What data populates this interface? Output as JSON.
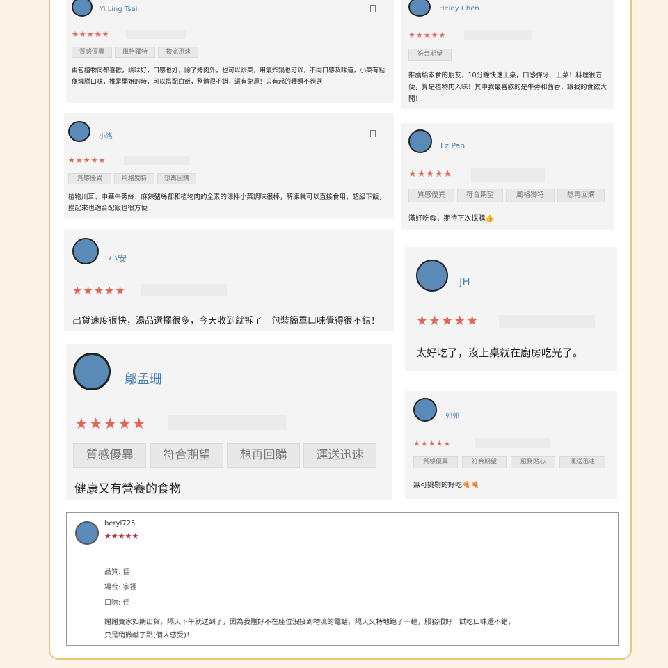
{
  "reviews": [
    {
      "name": "Yi Ling Tsai",
      "stars": "★★★★★",
      "tags": [
        "質感優異",
        "風格獨特",
        "物流迅速"
      ],
      "text": "兩包植物肉都喜歡，調味好，口感也好，除了烤肉外，也可以炒菜，用氣炸鍋也可以，不同口感及味道，小菜有點像燒臘口味，推是開始的時，可以搭配白飯，整體很不錯，還有免運！只有起的種類不夠選"
    },
    {
      "name": "Heidy Chen",
      "stars": "★★★★★",
      "tags": [
        "符合期望"
      ],
      "text": "推薦給素食的朋友，10分鐘快速上桌，口感彈牙、上菜！料理很方便，算是植物肉入味！其中我最喜歡的是牛蒡和茴香，讓我的食欲大開！"
    },
    {
      "name": "小洛",
      "stars": "★★★★★",
      "tags": [
        "質感優異",
        "風格獨特",
        "想再回購"
      ],
      "text": "植物川耳、中華牛蒡絲、麻辣豬絲都和植物肉的全素的涼拌小菜調味很棒，解凍就可以直接食用，超級下飯，撈起來也適合配飯也很方便"
    },
    {
      "name": "Lz Pan",
      "stars": "★★★★★",
      "tags": [
        "質感優異",
        "符合期望",
        "風格獨特",
        "想再回購"
      ],
      "text": "滿好吃😋，期待下次採購👍"
    },
    {
      "name": "小安",
      "stars": "★★★★★",
      "tags": [],
      "text": "出貨速度很快，湯品選擇很多，今天收到就拆了　包裝簡單口味覺得很不錯！"
    },
    {
      "name": "JH",
      "stars": "★★★★★",
      "tags": [],
      "text": "太好吃了，沒上桌就在廚房吃光了。"
    },
    {
      "name": "鄔孟珊",
      "stars": "★★★★★",
      "tags": [
        "質感優異",
        "符合期望",
        "想再回購",
        "運送迅速"
      ],
      "text": "健康又有營養的食物"
    },
    {
      "name": "郭郭",
      "stars": "★★★★★",
      "tags": [
        "質感優異",
        "符合期望",
        "服務貼心",
        "運送迅速"
      ],
      "text": "無可挑剔的好吃🍕🍕"
    }
  ],
  "featured": {
    "name": "beryl725",
    "stars": "★★★★★",
    "quality": "品質: 佳",
    "occasion": "場合: 家裡",
    "taste": "口味: 佳",
    "text1": "謝謝賣家如期出貨，隔天下午就送到了，因為我剛好不在座位沒接到物流的電話，隔天又特地跑了一趟，服務很好！試吃口味還不錯，",
    "text2": "只是稍微鹹了點(個人感受)！"
  },
  "colors": {
    "star": "#e06757",
    "name": "#4a7fae",
    "frame": "#e7c879",
    "featured_star": "#c5283d"
  }
}
